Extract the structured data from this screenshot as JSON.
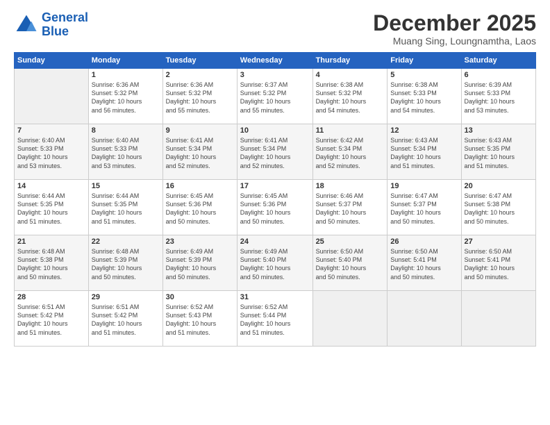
{
  "logo": {
    "line1": "General",
    "line2": "Blue"
  },
  "title": "December 2025",
  "subtitle": "Muang Sing, Loungnamtha, Laos",
  "days_header": [
    "Sunday",
    "Monday",
    "Tuesday",
    "Wednesday",
    "Thursday",
    "Friday",
    "Saturday"
  ],
  "weeks": [
    [
      {
        "num": "",
        "info": ""
      },
      {
        "num": "1",
        "info": "Sunrise: 6:36 AM\nSunset: 5:32 PM\nDaylight: 10 hours\nand 56 minutes."
      },
      {
        "num": "2",
        "info": "Sunrise: 6:36 AM\nSunset: 5:32 PM\nDaylight: 10 hours\nand 55 minutes."
      },
      {
        "num": "3",
        "info": "Sunrise: 6:37 AM\nSunset: 5:32 PM\nDaylight: 10 hours\nand 55 minutes."
      },
      {
        "num": "4",
        "info": "Sunrise: 6:38 AM\nSunset: 5:32 PM\nDaylight: 10 hours\nand 54 minutes."
      },
      {
        "num": "5",
        "info": "Sunrise: 6:38 AM\nSunset: 5:33 PM\nDaylight: 10 hours\nand 54 minutes."
      },
      {
        "num": "6",
        "info": "Sunrise: 6:39 AM\nSunset: 5:33 PM\nDaylight: 10 hours\nand 53 minutes."
      }
    ],
    [
      {
        "num": "7",
        "info": "Sunrise: 6:40 AM\nSunset: 5:33 PM\nDaylight: 10 hours\nand 53 minutes."
      },
      {
        "num": "8",
        "info": "Sunrise: 6:40 AM\nSunset: 5:33 PM\nDaylight: 10 hours\nand 53 minutes."
      },
      {
        "num": "9",
        "info": "Sunrise: 6:41 AM\nSunset: 5:34 PM\nDaylight: 10 hours\nand 52 minutes."
      },
      {
        "num": "10",
        "info": "Sunrise: 6:41 AM\nSunset: 5:34 PM\nDaylight: 10 hours\nand 52 minutes."
      },
      {
        "num": "11",
        "info": "Sunrise: 6:42 AM\nSunset: 5:34 PM\nDaylight: 10 hours\nand 52 minutes."
      },
      {
        "num": "12",
        "info": "Sunrise: 6:43 AM\nSunset: 5:34 PM\nDaylight: 10 hours\nand 51 minutes."
      },
      {
        "num": "13",
        "info": "Sunrise: 6:43 AM\nSunset: 5:35 PM\nDaylight: 10 hours\nand 51 minutes."
      }
    ],
    [
      {
        "num": "14",
        "info": "Sunrise: 6:44 AM\nSunset: 5:35 PM\nDaylight: 10 hours\nand 51 minutes."
      },
      {
        "num": "15",
        "info": "Sunrise: 6:44 AM\nSunset: 5:35 PM\nDaylight: 10 hours\nand 51 minutes."
      },
      {
        "num": "16",
        "info": "Sunrise: 6:45 AM\nSunset: 5:36 PM\nDaylight: 10 hours\nand 50 minutes."
      },
      {
        "num": "17",
        "info": "Sunrise: 6:45 AM\nSunset: 5:36 PM\nDaylight: 10 hours\nand 50 minutes."
      },
      {
        "num": "18",
        "info": "Sunrise: 6:46 AM\nSunset: 5:37 PM\nDaylight: 10 hours\nand 50 minutes."
      },
      {
        "num": "19",
        "info": "Sunrise: 6:47 AM\nSunset: 5:37 PM\nDaylight: 10 hours\nand 50 minutes."
      },
      {
        "num": "20",
        "info": "Sunrise: 6:47 AM\nSunset: 5:38 PM\nDaylight: 10 hours\nand 50 minutes."
      }
    ],
    [
      {
        "num": "21",
        "info": "Sunrise: 6:48 AM\nSunset: 5:38 PM\nDaylight: 10 hours\nand 50 minutes."
      },
      {
        "num": "22",
        "info": "Sunrise: 6:48 AM\nSunset: 5:39 PM\nDaylight: 10 hours\nand 50 minutes."
      },
      {
        "num": "23",
        "info": "Sunrise: 6:49 AM\nSunset: 5:39 PM\nDaylight: 10 hours\nand 50 minutes."
      },
      {
        "num": "24",
        "info": "Sunrise: 6:49 AM\nSunset: 5:40 PM\nDaylight: 10 hours\nand 50 minutes."
      },
      {
        "num": "25",
        "info": "Sunrise: 6:50 AM\nSunset: 5:40 PM\nDaylight: 10 hours\nand 50 minutes."
      },
      {
        "num": "26",
        "info": "Sunrise: 6:50 AM\nSunset: 5:41 PM\nDaylight: 10 hours\nand 50 minutes."
      },
      {
        "num": "27",
        "info": "Sunrise: 6:50 AM\nSunset: 5:41 PM\nDaylight: 10 hours\nand 50 minutes."
      }
    ],
    [
      {
        "num": "28",
        "info": "Sunrise: 6:51 AM\nSunset: 5:42 PM\nDaylight: 10 hours\nand 51 minutes."
      },
      {
        "num": "29",
        "info": "Sunrise: 6:51 AM\nSunset: 5:42 PM\nDaylight: 10 hours\nand 51 minutes."
      },
      {
        "num": "30",
        "info": "Sunrise: 6:52 AM\nSunset: 5:43 PM\nDaylight: 10 hours\nand 51 minutes."
      },
      {
        "num": "31",
        "info": "Sunrise: 6:52 AM\nSunset: 5:44 PM\nDaylight: 10 hours\nand 51 minutes."
      },
      {
        "num": "",
        "info": ""
      },
      {
        "num": "",
        "info": ""
      },
      {
        "num": "",
        "info": ""
      }
    ]
  ]
}
